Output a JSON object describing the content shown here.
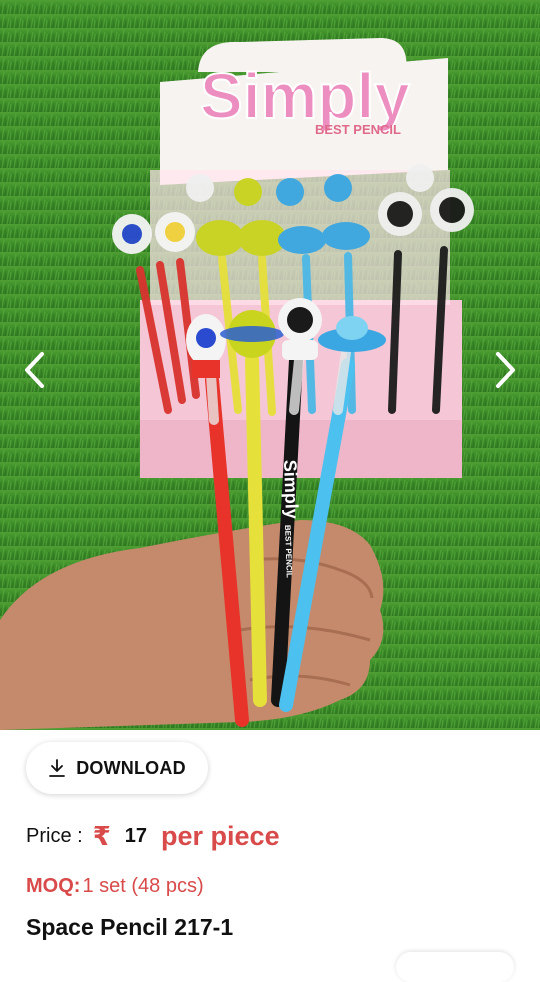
{
  "product_image": {
    "box_brand": "Simply",
    "box_subtitle": "BEST PENCIL",
    "pencil_brand": "Simply",
    "pencil_subtitle": "BEST PENCIL"
  },
  "gallery": {
    "prev_icon": "chevron-left-icon",
    "next_icon": "chevron-right-icon"
  },
  "download": {
    "icon": "download-icon",
    "label": "DOWNLOAD"
  },
  "price": {
    "label": "Price :",
    "currency": "₹",
    "value": "17",
    "unit": "per piece"
  },
  "moq": {
    "label": "MOQ:",
    "value": "1 set (48 pcs)"
  },
  "product": {
    "title": "Space Pencil 217-1"
  },
  "colors": {
    "accent": "#d94a4a",
    "grass": "#3c8f2a",
    "box_pink": "#f4c6d6"
  }
}
